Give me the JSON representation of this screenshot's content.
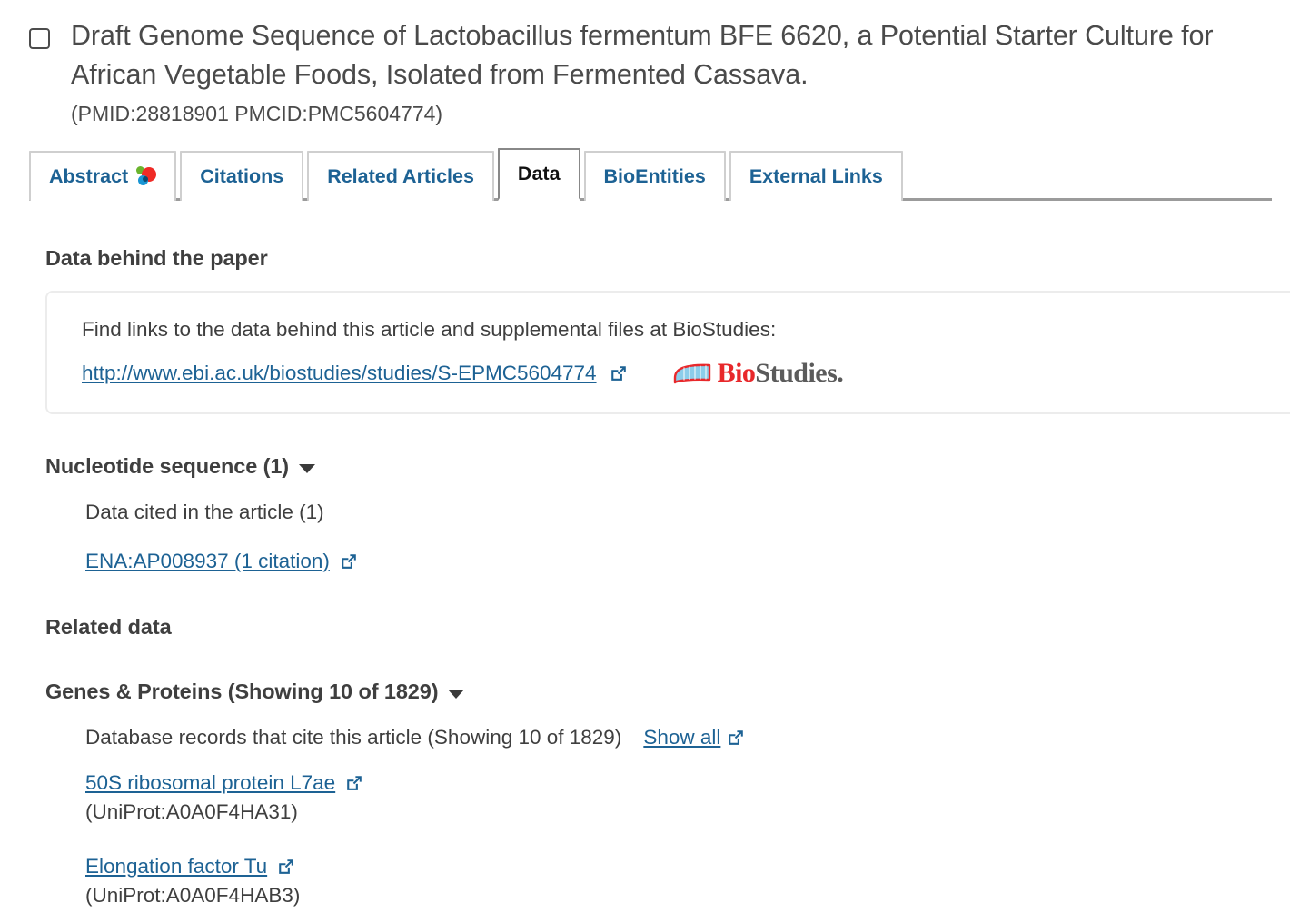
{
  "article": {
    "title": "Draft Genome Sequence of Lactobacillus fermentum BFE 6620, a Potential Starter Culture for African Vegetable Foods, Isolated from Fermented Cassava.",
    "ids": "(PMID:28818901 PMCID:PMC5604774)"
  },
  "tabs": [
    {
      "label": "Abstract",
      "icon": "altmetric-donut-icon",
      "active": false
    },
    {
      "label": "Citations",
      "icon": "",
      "active": false
    },
    {
      "label": "Related Articles",
      "icon": "",
      "active": false
    },
    {
      "label": "Data",
      "icon": "",
      "active": true
    },
    {
      "label": "BioEntities",
      "icon": "",
      "active": false
    },
    {
      "label": "External Links",
      "icon": "",
      "active": false
    }
  ],
  "data_behind_paper": {
    "heading": "Data behind the paper",
    "description": "Find links to the data behind this article and supplemental files at BioStudies:",
    "link_text": "http://www.ebi.ac.uk/biostudies/studies/S-EPMC5604774",
    "logo": {
      "part1": "Bio",
      "part2": "Studies."
    }
  },
  "nucleotide_section": {
    "heading": "Nucleotide sequence (1)",
    "subtitle": "Data cited in the article (1)",
    "entries": [
      {
        "link_text": "ENA:AP008937 (1 citation)"
      }
    ]
  },
  "related_data": {
    "heading": "Related data",
    "group_heading": "Genes & Proteins (Showing 10 of 1829)",
    "description": "Database records that cite this article (Showing 10 of 1829)",
    "show_all_label": "Show all",
    "records": [
      {
        "name": "50S ribosomal protein L7ae",
        "accession": "(UniProt:A0A0F4HA31)"
      },
      {
        "name": "Elongation factor Tu",
        "accession": "(UniProt:A0A0F4HAB3)"
      }
    ]
  },
  "colors": {
    "link": "#1d6294",
    "heading": "#3f3f3f",
    "title": "#4a4a4a",
    "tab_border": "#cfcfcf",
    "tab_active_border": "#888888",
    "strip_line": "#9b9b9b",
    "box_border": "#ececec",
    "logo_red": "#e8282b",
    "logo_gray": "#5b5b5b",
    "logo_blue": "#8ccdea",
    "altmetric_green": "#6ab42d",
    "altmetric_red": "#ef2b26",
    "altmetric_blue": "#1996d4"
  }
}
